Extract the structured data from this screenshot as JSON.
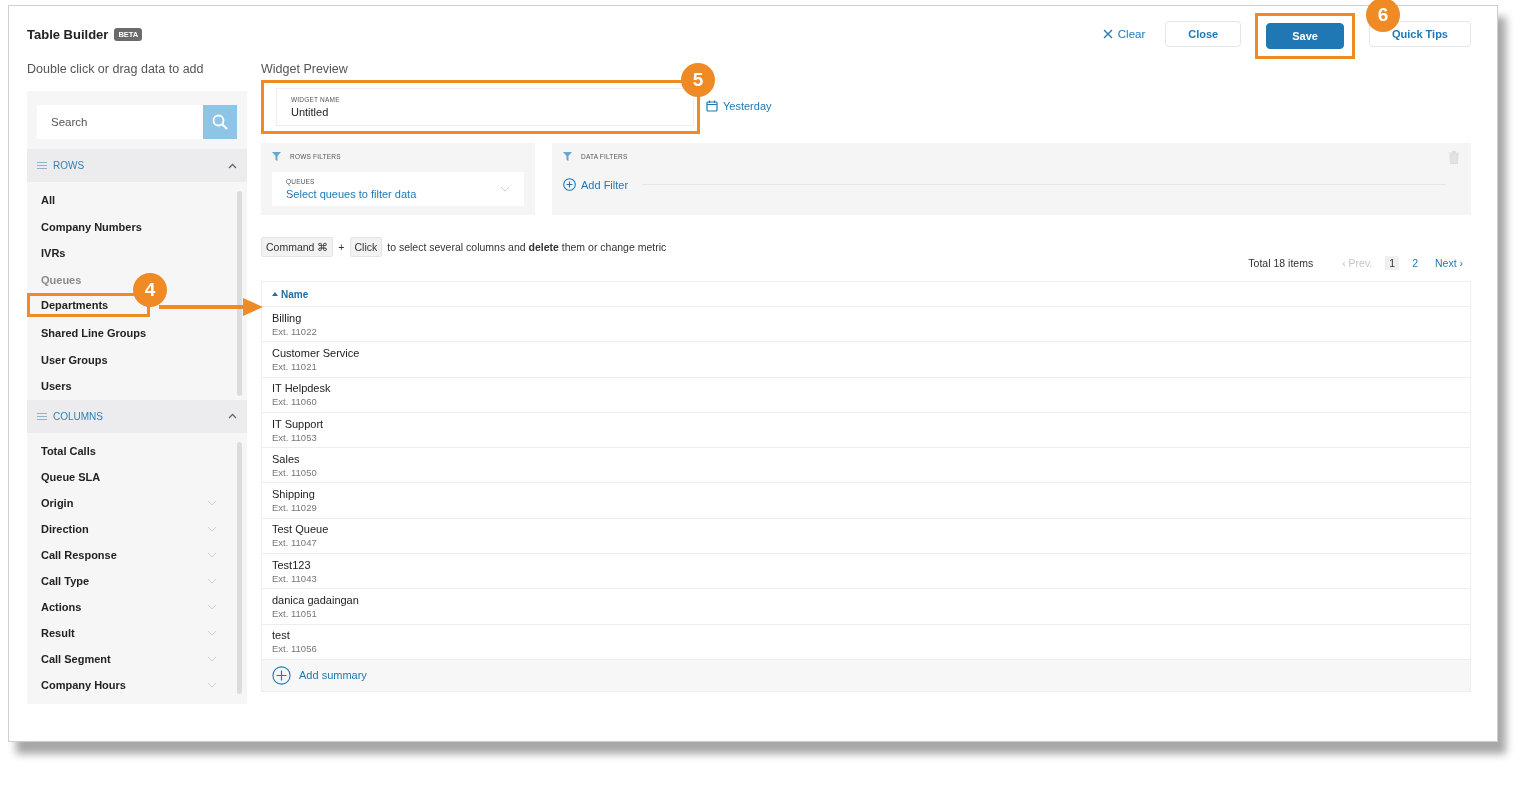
{
  "header": {
    "title": "Table Builder",
    "badge": "BETA",
    "actions": [
      {
        "label": "Clear",
        "kind": "clear"
      },
      {
        "label": "Close",
        "kind": "outline"
      },
      {
        "label": "Save",
        "kind": "primary",
        "callout": "6"
      },
      {
        "label": "Quick Tips",
        "kind": "outline"
      }
    ]
  },
  "sidebar": {
    "caption": "Double click or drag data to add",
    "search": {
      "placeholder": "Search"
    },
    "sections": [
      {
        "title": "ROWS",
        "expanded": true,
        "items": [
          {
            "label": "All",
            "disabled": false
          },
          {
            "label": "Company Numbers",
            "disabled": false
          },
          {
            "label": "IVRs",
            "disabled": false
          },
          {
            "label": "Queues",
            "disabled": true
          },
          {
            "label": "Departments",
            "disabled": false,
            "callout": "4"
          },
          {
            "label": "Shared Line Groups",
            "disabled": false
          },
          {
            "label": "User Groups",
            "disabled": false
          },
          {
            "label": "Users",
            "disabled": false
          }
        ]
      },
      {
        "title": "COLUMNS",
        "expanded": true,
        "items": [
          {
            "label": "Total Calls",
            "expandable": false
          },
          {
            "label": "Queue SLA",
            "expandable": false
          },
          {
            "label": "Origin",
            "expandable": true
          },
          {
            "label": "Direction",
            "expandable": true
          },
          {
            "label": "Call Response",
            "expandable": true
          },
          {
            "label": "Call Type",
            "expandable": true
          },
          {
            "label": "Actions",
            "expandable": true
          },
          {
            "label": "Result",
            "expandable": true
          },
          {
            "label": "Call Segment",
            "expandable": true
          },
          {
            "label": "Company Hours",
            "expandable": true
          }
        ]
      }
    ]
  },
  "preview": {
    "caption": "Widget Preview",
    "widget_name": {
      "label": "WIDGET NAME",
      "value": "Untitled",
      "callout": "5"
    },
    "date": {
      "label": "Yesterday"
    },
    "rows_filters": {
      "title": "ROWS FILTERS",
      "dropdown": {
        "label": "QUEUES",
        "prompt": "Select queues to filter data"
      }
    },
    "data_filters": {
      "title": "DATA FILTERS",
      "add": "Add Filter"
    },
    "hint": {
      "keys": [
        "Command ⌘",
        "Click"
      ],
      "joiner": "+",
      "text": "to select several columns and **delete** them or change metric"
    },
    "pagination": {
      "total": "Total 18 items",
      "prev": {
        "label": "‹ Prev.",
        "disabled": true
      },
      "pages": [
        {
          "label": "1",
          "selected": true
        },
        {
          "label": "2",
          "selected": false
        }
      ],
      "next": {
        "label": "Next ›",
        "disabled": false
      }
    },
    "table": {
      "columns": [
        {
          "label": "Name",
          "sorted": true
        }
      ],
      "rows": [
        {
          "name": "Billing",
          "ext": "Ext. 11022"
        },
        {
          "name": "Customer Service",
          "ext": "Ext. 11021"
        },
        {
          "name": "IT Helpdesk",
          "ext": "Ext. 11060"
        },
        {
          "name": "IT Support",
          "ext": "Ext. 11053"
        },
        {
          "name": "Sales",
          "ext": "Ext. 11050"
        },
        {
          "name": "Shipping",
          "ext": "Ext. 11029"
        },
        {
          "name": "Test Queue",
          "ext": "Ext. 11047"
        },
        {
          "name": "Test123",
          "ext": "Ext. 11043"
        },
        {
          "name": "danica gadaingan",
          "ext": "Ext. 11051"
        },
        {
          "name": "test",
          "ext": "Ext. 11056"
        }
      ],
      "add_summary": "Add summary"
    }
  }
}
